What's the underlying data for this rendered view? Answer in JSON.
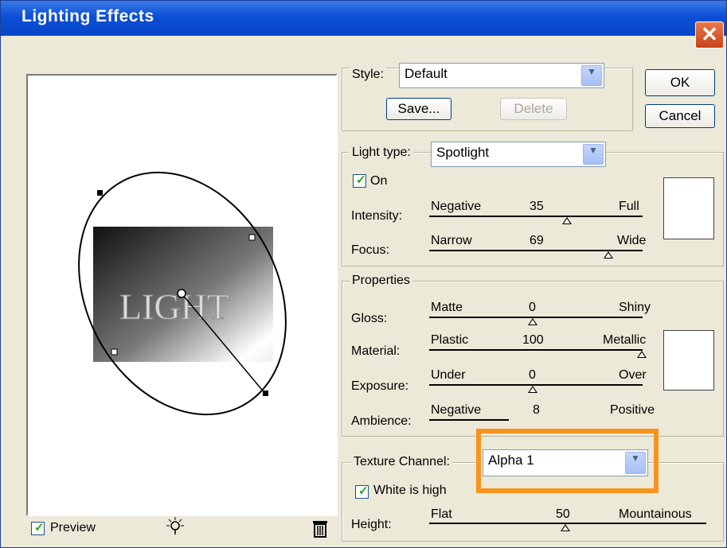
{
  "window": {
    "title": "Lighting Effects",
    "close_icon": "✕"
  },
  "style": {
    "label": "Style:",
    "value": "Default",
    "save": "Save...",
    "delete": "Delete"
  },
  "buttons": {
    "ok": "OK",
    "cancel": "Cancel"
  },
  "light": {
    "label": "Light type:",
    "value": "Spotlight",
    "on_label": "On",
    "on_checked": true,
    "intensity": {
      "label": "Intensity:",
      "min": "Negative",
      "value": "35",
      "max": "Full"
    },
    "focus": {
      "label": "Focus:",
      "min": "Narrow",
      "value": "69",
      "max": "Wide"
    }
  },
  "properties": {
    "label": "Properties",
    "gloss": {
      "label": "Gloss:",
      "min": "Matte",
      "value": "0",
      "max": "Shiny"
    },
    "material": {
      "label": "Material:",
      "min": "Plastic",
      "value": "100",
      "max": "Metallic"
    },
    "exposure": {
      "label": "Exposure:",
      "min": "Under",
      "value": "0",
      "max": "Over"
    },
    "ambience": {
      "label": "Ambience:",
      "min": "Negative",
      "value": "8",
      "max": "Positive"
    }
  },
  "texture": {
    "label": "Texture Channel:",
    "value": "Alpha 1",
    "white_high_label": "White is high",
    "white_high_checked": true,
    "height": {
      "label": "Height:",
      "min": "Flat",
      "value": "50",
      "max": "Mountainous"
    }
  },
  "preview": {
    "label": "Preview",
    "checked": true,
    "image_text": "LIGHT",
    "lightbulb_icon": "lightbulb-icon",
    "trash_icon": "trash-icon"
  },
  "colors": {
    "title_bar": "#0a4fd6",
    "dialog_bg": "#ece9d8",
    "highlight": "#f7941d"
  }
}
